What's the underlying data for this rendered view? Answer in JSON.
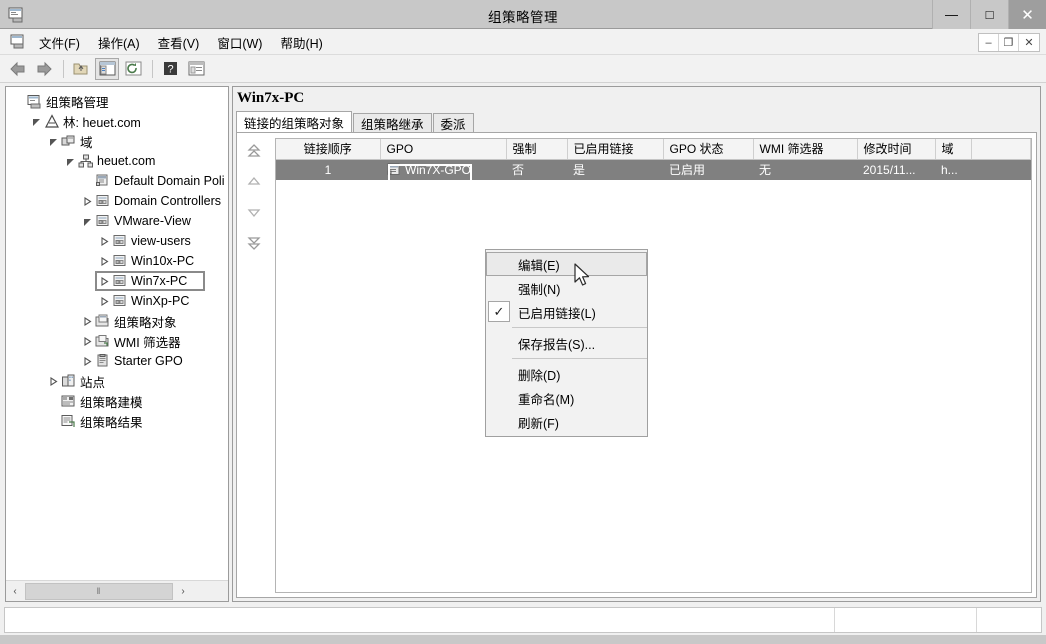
{
  "window": {
    "title": "组策略管理",
    "app_icon": "console-icon",
    "controls": [
      {
        "name": "minimize-button",
        "glyph": "—"
      },
      {
        "name": "maximize-button",
        "glyph": "□"
      },
      {
        "name": "close-button",
        "glyph": "✕"
      }
    ],
    "mdi_controls": [
      {
        "name": "mdi-minimize-button",
        "glyph": "–"
      },
      {
        "name": "mdi-restore-button",
        "glyph": "❐"
      },
      {
        "name": "mdi-close-button",
        "glyph": "✕"
      }
    ]
  },
  "menubar": {
    "icon": "console-icon",
    "items": [
      {
        "label": "文件(F)"
      },
      {
        "label": "操作(A)"
      },
      {
        "label": "查看(V)"
      },
      {
        "label": "窗口(W)"
      },
      {
        "label": "帮助(H)"
      }
    ]
  },
  "toolbar": {
    "buttons": [
      {
        "name": "back-button",
        "icon": "left-arrow-icon"
      },
      {
        "name": "forward-button",
        "icon": "right-arrow-icon"
      },
      {
        "name": "up-one-level-button",
        "icon": "up-folder-icon"
      },
      {
        "name": "show-hide-tree-button",
        "icon": "console-tree-icon"
      },
      {
        "name": "refresh-button",
        "icon": "refresh-icon"
      },
      {
        "name": "help-button",
        "icon": "question-mark-icon"
      },
      {
        "name": "properties-button",
        "icon": "properties-icon"
      }
    ]
  },
  "tree": {
    "root": "组策略管理",
    "nodes": [
      {
        "label": "组策略管理",
        "depth": 0,
        "twist": "",
        "icon": "console-root-icon",
        "selected": false
      },
      {
        "label": "林: heuet.com",
        "depth": 1,
        "twist": "expanded",
        "icon": "forest-icon",
        "selected": false
      },
      {
        "label": "域",
        "depth": 2,
        "twist": "expanded",
        "icon": "domains-icon",
        "selected": false
      },
      {
        "label": "heuet.com",
        "depth": 3,
        "twist": "expanded",
        "icon": "domain-icon",
        "selected": false
      },
      {
        "label": "Default Domain Poli",
        "depth": 4,
        "twist": "",
        "icon": "gpo-link-icon",
        "selected": false
      },
      {
        "label": "Domain Controllers",
        "depth": 4,
        "twist": "collapsed",
        "icon": "ou-icon",
        "selected": false
      },
      {
        "label": "VMware-View",
        "depth": 4,
        "twist": "expanded",
        "icon": "ou-icon",
        "selected": false
      },
      {
        "label": "view-users",
        "depth": 5,
        "twist": "collapsed",
        "icon": "ou-icon",
        "selected": false
      },
      {
        "label": "Win10x-PC",
        "depth": 5,
        "twist": "collapsed",
        "icon": "ou-icon",
        "selected": false
      },
      {
        "label": "Win7x-PC",
        "depth": 5,
        "twist": "collapsed",
        "icon": "ou-icon",
        "selected": true
      },
      {
        "label": "WinXp-PC",
        "depth": 5,
        "twist": "collapsed",
        "icon": "ou-icon",
        "selected": false
      },
      {
        "label": "组策略对象",
        "depth": 4,
        "twist": "collapsed",
        "icon": "gpo-folder-icon",
        "selected": false
      },
      {
        "label": "WMI 筛选器",
        "depth": 4,
        "twist": "collapsed",
        "icon": "wmi-folder-icon",
        "selected": false
      },
      {
        "label": "Starter GPO",
        "depth": 4,
        "twist": "collapsed",
        "icon": "starter-gpo-icon",
        "selected": false
      },
      {
        "label": "站点",
        "depth": 2,
        "twist": "collapsed",
        "icon": "sites-icon",
        "selected": false
      },
      {
        "label": "组策略建模",
        "depth": 2,
        "twist": "",
        "icon": "modeling-icon",
        "selected": false
      },
      {
        "label": "组策略结果",
        "depth": 2,
        "twist": "",
        "icon": "results-icon",
        "selected": false
      }
    ],
    "scrollbar": {
      "left_glyph": "‹",
      "right_glyph": "›",
      "thumb_grip": "‖"
    }
  },
  "rightpane": {
    "title": "Win7x-PC",
    "tabs": [
      {
        "label": "链接的组策略对象",
        "active": true
      },
      {
        "label": "组策略继承",
        "active": false
      },
      {
        "label": "委派",
        "active": false
      }
    ],
    "order_buttons": [
      {
        "name": "move-link-to-top-button",
        "icon": "double-up-arrow-icon"
      },
      {
        "name": "move-link-up-button",
        "icon": "up-arrow-icon"
      },
      {
        "name": "move-link-down-button",
        "icon": "down-arrow-icon"
      },
      {
        "name": "move-link-to-bottom-button",
        "icon": "double-down-arrow-icon"
      }
    ],
    "table": {
      "columns": [
        {
          "label": "链接顺序",
          "key": "order"
        },
        {
          "label": "GPO",
          "key": "gpo"
        },
        {
          "label": "强制",
          "key": "enforced"
        },
        {
          "label": "已启用链接",
          "key": "link_enabled"
        },
        {
          "label": "GPO 状态",
          "key": "gpo_status"
        },
        {
          "label": "WMI 筛选器",
          "key": "wmi_filter"
        },
        {
          "label": "修改时间",
          "key": "modified"
        },
        {
          "label": "域",
          "key": "domain"
        },
        {
          "label": "",
          "key": "spacer"
        }
      ],
      "rows": [
        {
          "order": "1",
          "gpo": "Win7X-GPO",
          "gpo_icon": "gpo-link-icon",
          "enforced": "否",
          "link_enabled": "是",
          "gpo_status": "已启用",
          "wmi_filter": "无",
          "modified": "2015/11...",
          "domain": "h...",
          "spacer": "",
          "selected": true
        }
      ]
    }
  },
  "context_menu": {
    "items": [
      {
        "label": "编辑(E)",
        "highlighted": true,
        "checked": false,
        "separator_after": false
      },
      {
        "label": "强制(N)",
        "highlighted": false,
        "checked": false,
        "separator_after": false
      },
      {
        "label": "已启用链接(L)",
        "highlighted": false,
        "checked": true,
        "separator_after": true
      },
      {
        "label": "保存报告(S)...",
        "highlighted": false,
        "checked": false,
        "separator_after": true
      },
      {
        "label": "删除(D)",
        "highlighted": false,
        "checked": false,
        "separator_after": false
      },
      {
        "label": "重命名(M)",
        "highlighted": false,
        "checked": false,
        "separator_after": false
      },
      {
        "label": "刷新(F)",
        "highlighted": false,
        "checked": false,
        "separator_after": false
      }
    ],
    "check_glyph": "✓"
  },
  "statusbar": {
    "main_text": "",
    "panel2_text": "",
    "panel3_text": ""
  },
  "colors": {
    "titlebar": "#c8c8c8",
    "selection": "#808080",
    "close_button": "#9e9e9e",
    "pane_border": "#9b9b9b"
  }
}
